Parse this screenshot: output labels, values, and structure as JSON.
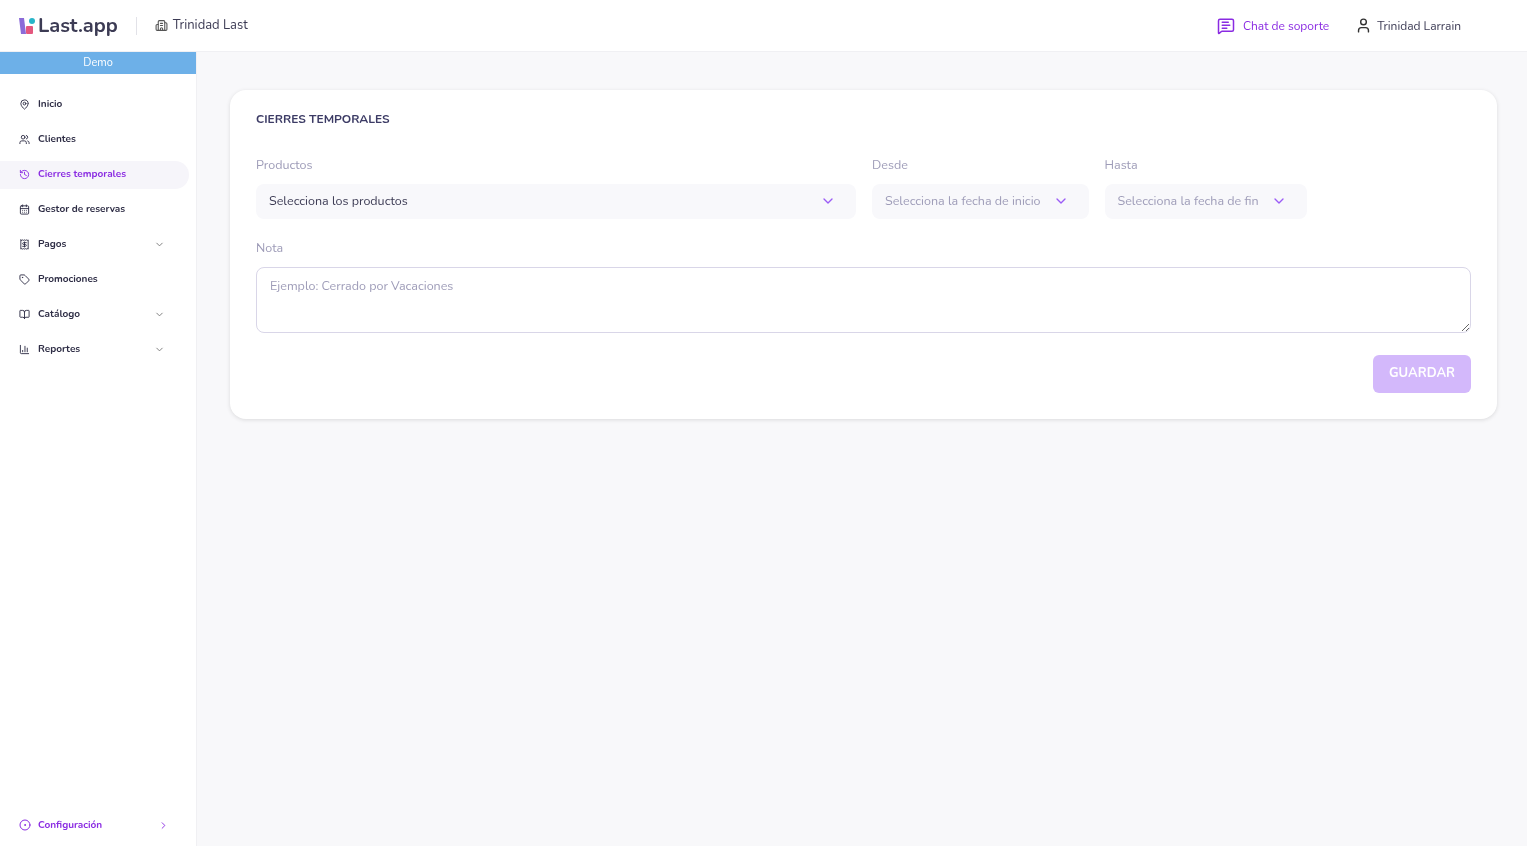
{
  "header": {
    "logo": "Last.app",
    "venue": "Trinidad Last",
    "support_link": "Chat de soporte",
    "user": "Trinidad Larrain"
  },
  "sidebar": {
    "banner": "Demo",
    "items": [
      {
        "label": "Inicio",
        "kind": "link",
        "selected": false
      },
      {
        "label": "Clientes",
        "kind": "link",
        "selected": false
      },
      {
        "label": "Cierres temporales",
        "kind": "link",
        "selected": true
      },
      {
        "label": "Gestor de reservas",
        "kind": "link",
        "selected": false
      },
      {
        "label": "Pagos",
        "kind": "group",
        "selected": false
      },
      {
        "label": "Promociones",
        "kind": "link",
        "selected": false
      },
      {
        "label": "Catálogo",
        "kind": "group",
        "selected": false
      },
      {
        "label": "Reportes",
        "kind": "group",
        "selected": false
      }
    ],
    "footer_item": {
      "label": "Configuración"
    }
  },
  "form": {
    "title": "CIERRES TEMPORALES",
    "selects": [
      {
        "label": "Productos",
        "placeholder": "Selecciona los productos",
        "kind": "wide"
      },
      {
        "label": "Desde",
        "placeholder": "Selecciona la fecha de inicio",
        "kind": "date"
      },
      {
        "label": "Hasta",
        "placeholder": "Selecciona la fecha de fin",
        "kind": "date"
      }
    ],
    "note": {
      "label": "Nota",
      "placeholder": "Ejemplo: Cerrado por Vacaciones"
    },
    "save_button": {
      "label": "GUARDAR",
      "disabled": true
    }
  }
}
